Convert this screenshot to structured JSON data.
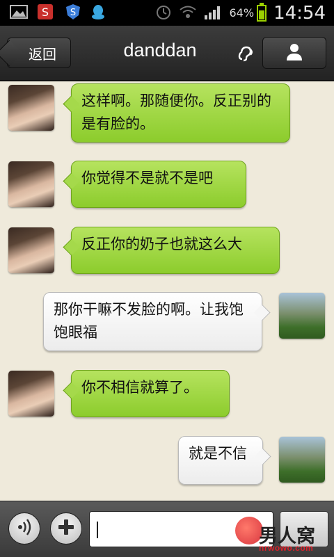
{
  "status_bar": {
    "battery_percent": "64%",
    "battery_level": 0.64,
    "time": "14:54",
    "icons": [
      "gallery-icon",
      "s-app-icon",
      "shield-app-icon",
      "qq-icon",
      "alarm-icon",
      "wifi-icon",
      "signal-icon",
      "battery-icon"
    ]
  },
  "header": {
    "back_label": "返回",
    "title": "danddan",
    "icons": [
      "earpiece-mode-icon",
      "contact-profile-icon"
    ]
  },
  "messages": [
    {
      "side": "in",
      "text": "这样啊。那随便你。反正别的是有脸的。"
    },
    {
      "side": "in",
      "text": "你觉得不是就不是吧"
    },
    {
      "side": "in",
      "text": "反正你的奶子也就这么大"
    },
    {
      "side": "out",
      "text": "那你干嘛不发脸的啊。让我饱饱眼福"
    },
    {
      "side": "in",
      "text": "你不相信就算了。"
    },
    {
      "side": "out",
      "text": "就是不信"
    }
  ],
  "input_bar": {
    "icons": [
      "voice-icon",
      "plus-icon"
    ],
    "input_value": "",
    "watermark_text": "男人窝",
    "watermark_url": "nrwowo.com"
  },
  "colors": {
    "incoming_bubble": "#9ed646",
    "outgoing_bubble": "#ffffff",
    "chat_background": "#efeadb",
    "header_background": "#2e2e2e"
  }
}
